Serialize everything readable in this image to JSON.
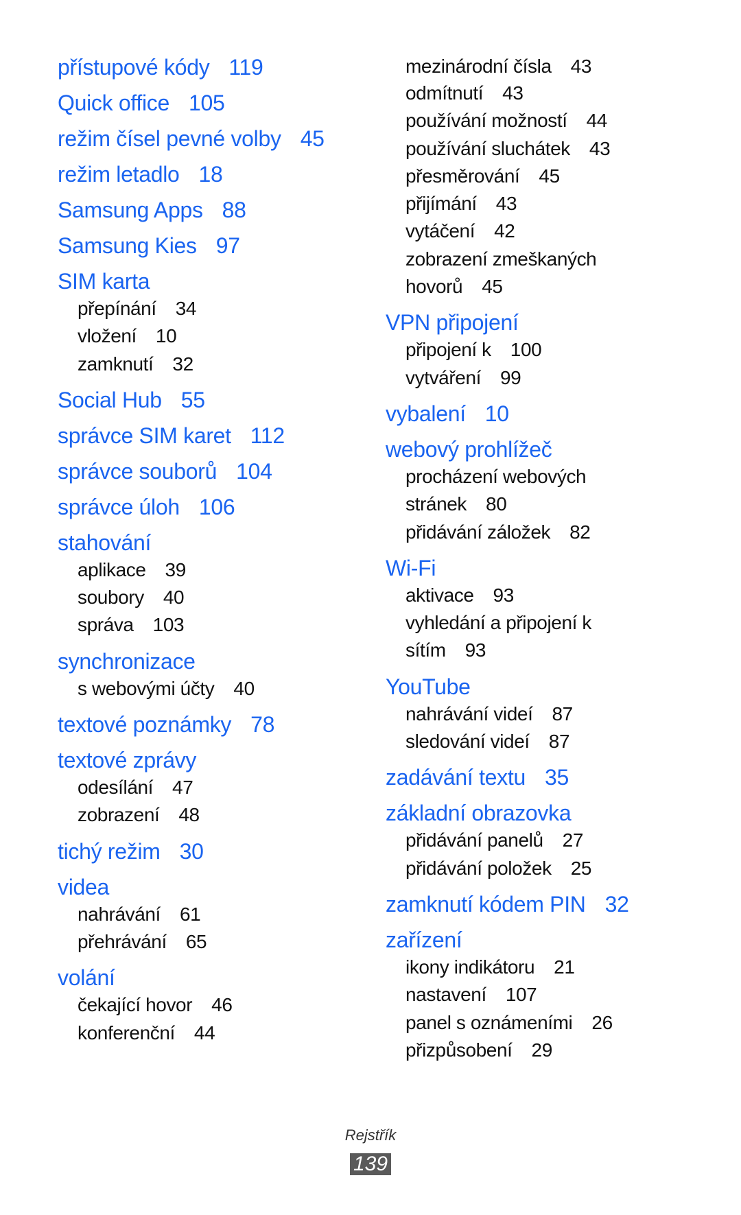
{
  "left_column": [
    {
      "term": "přístupové kódy",
      "page": "119"
    },
    {
      "term": "Quick office",
      "page": "105"
    },
    {
      "term": "režim čísel pevné volby",
      "page": "45"
    },
    {
      "term": "režim letadlo",
      "page": "18"
    },
    {
      "term": "Samsung Apps",
      "page": "88"
    },
    {
      "term": "Samsung Kies",
      "page": "97"
    },
    {
      "term": "SIM karta",
      "page": "",
      "subs": [
        {
          "term": "přepínání",
          "page": "34"
        },
        {
          "term": "vložení",
          "page": "10"
        },
        {
          "term": "zamknutí",
          "page": "32"
        }
      ]
    },
    {
      "term": "Social Hub",
      "page": "55"
    },
    {
      "term": "správce SIM karet",
      "page": "112"
    },
    {
      "term": "správce souborů",
      "page": "104"
    },
    {
      "term": "správce úloh",
      "page": "106"
    },
    {
      "term": "stahování",
      "page": "",
      "subs": [
        {
          "term": "aplikace",
          "page": "39"
        },
        {
          "term": "soubory",
          "page": "40"
        },
        {
          "term": "správa",
          "page": "103"
        }
      ]
    },
    {
      "term": "synchronizace",
      "page": "",
      "subs": [
        {
          "term": "s webovými účty",
          "page": "40"
        }
      ]
    },
    {
      "term": "textové poznámky",
      "page": "78"
    },
    {
      "term": "textové zprávy",
      "page": "",
      "subs": [
        {
          "term": "odesílání",
          "page": "47"
        },
        {
          "term": "zobrazení",
          "page": "48"
        }
      ]
    },
    {
      "term": "tichý režim",
      "page": "30"
    },
    {
      "term": "videa",
      "page": "",
      "subs": [
        {
          "term": "nahrávání",
          "page": "61"
        },
        {
          "term": "přehrávání",
          "page": "65"
        }
      ]
    },
    {
      "term": "volání",
      "page": "",
      "subs": [
        {
          "term": "čekající hovor",
          "page": "46"
        },
        {
          "term": "konferenční",
          "page": "44"
        }
      ]
    }
  ],
  "right_column_continued_subs": [
    {
      "term": "mezinárodní čísla",
      "page": "43"
    },
    {
      "term": "odmítnutí",
      "page": "43"
    },
    {
      "term": "používání možností",
      "page": "44"
    },
    {
      "term": "používání sluchátek",
      "page": "43"
    },
    {
      "term": "přesměrování",
      "page": "45"
    },
    {
      "term": "přijímání",
      "page": "43"
    },
    {
      "term": "vytáčení",
      "page": "42"
    },
    {
      "term": "zobrazení zmeškaných",
      "page": ""
    },
    {
      "term": "hovorů",
      "page": "45"
    }
  ],
  "right_column": [
    {
      "term": "VPN připojení",
      "page": "",
      "subs": [
        {
          "term": "připojení k",
          "page": "100"
        },
        {
          "term": "vytváření",
          "page": "99"
        }
      ]
    },
    {
      "term": "vybalení",
      "page": "10"
    },
    {
      "term": "webový prohlížeč",
      "page": "",
      "subs": [
        {
          "term": "procházení webových",
          "page": ""
        },
        {
          "term": "stránek",
          "page": "80"
        },
        {
          "term": "přidávání záložek",
          "page": "82"
        }
      ]
    },
    {
      "term": "Wi-Fi",
      "page": "",
      "subs": [
        {
          "term": "aktivace",
          "page": "93"
        },
        {
          "term": "vyhledání a připojení k",
          "page": ""
        },
        {
          "term": "sítím",
          "page": "93"
        }
      ]
    },
    {
      "term": "YouTube",
      "page": "",
      "subs": [
        {
          "term": "nahrávání videí",
          "page": "87"
        },
        {
          "term": "sledování videí",
          "page": "87"
        }
      ]
    },
    {
      "term": "zadávání textu",
      "page": "35"
    },
    {
      "term": "základní obrazovka",
      "page": "",
      "subs": [
        {
          "term": "přidávání panelů",
          "page": "27"
        },
        {
          "term": "přidávání položek",
          "page": "25"
        }
      ]
    },
    {
      "term": "zamknutí kódem PIN",
      "page": "32"
    },
    {
      "term": "zařízení",
      "page": "",
      "subs": [
        {
          "term": "ikony indikátoru",
          "page": "21"
        },
        {
          "term": "nastavení",
          "page": "107"
        },
        {
          "term": "panel s oznámeními",
          "page": "26"
        },
        {
          "term": "přizpůsobení",
          "page": "29"
        }
      ]
    }
  ],
  "footer": {
    "section_title": "Rejstřík",
    "page_number": "139"
  },
  "colors": {
    "main_entry": "#1a64f0",
    "sub_entry": "#111111",
    "page_badge": "#5a5a5a"
  }
}
